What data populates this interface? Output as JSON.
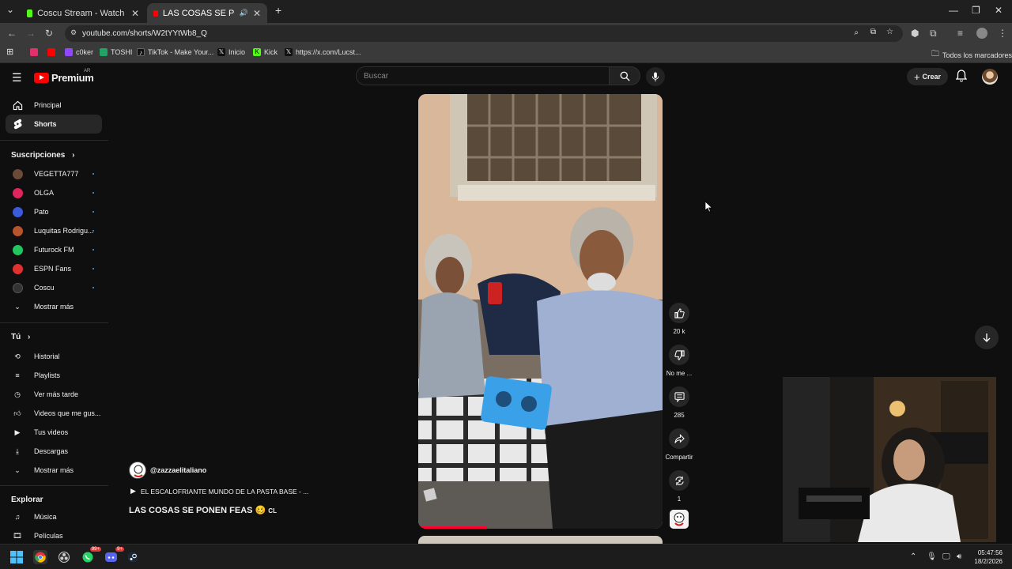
{
  "browser": {
    "tabs": [
      {
        "title": "Coscu Stream - Watch Live on K",
        "active": false
      },
      {
        "title": "LAS COSAS SE PONEN FEAS",
        "active": true
      }
    ],
    "new_tab": "+",
    "url": "youtube.com/shorts/W2tYYtWb8_Q",
    "bookmarks": [
      {
        "label": "",
        "icon": "instagram-icon",
        "color": "#e1306c"
      },
      {
        "label": "",
        "icon": "youtube-icon",
        "color": "#ff0000"
      },
      {
        "label": "c0ker",
        "icon": "twitch-icon",
        "color": "#9146ff"
      },
      {
        "label": "TOSHI",
        "icon": "sheets-icon",
        "color": "#21a366"
      },
      {
        "label": "TikTok - Make Your...",
        "icon": "tiktok-icon",
        "color": "#111"
      },
      {
        "label": "Inicio",
        "icon": "x-icon",
        "color": "#111"
      },
      {
        "label": "Kick",
        "icon": "kick-icon",
        "color": "#53fc18"
      },
      {
        "label": "https://x.com/Lucst...",
        "icon": "x-icon",
        "color": "#111"
      }
    ],
    "all_bookmarks": "Todos los marcadores"
  },
  "youtube": {
    "logo_text": "Premium",
    "region": "AR",
    "search_placeholder": "Buscar",
    "create_label": "Crear",
    "nav": [
      {
        "label": "Principal",
        "icon": "home-icon"
      },
      {
        "label": "Shorts",
        "icon": "shorts-icon",
        "active": true
      }
    ],
    "subscriptions_heading": "Suscripciones",
    "subscriptions": [
      {
        "label": "VEGETTA777",
        "color": "#6a4b3a"
      },
      {
        "label": "OLGA",
        "color": "#e0245e"
      },
      {
        "label": "Pato",
        "color": "#3b5bdb"
      },
      {
        "label": "Luquitas Rodrigu...",
        "color": "#b5542d"
      },
      {
        "label": "Futurock FM",
        "color": "#22c55e"
      },
      {
        "label": "ESPN Fans",
        "color": "#e03131"
      },
      {
        "label": "Coscu",
        "color": "#333333"
      }
    ],
    "show_more_1": "Mostrar más",
    "you_heading": "Tú",
    "you_items": [
      {
        "label": "Historial",
        "icon": "history-icon"
      },
      {
        "label": "Playlists",
        "icon": "playlist-icon"
      },
      {
        "label": "Ver más tarde",
        "icon": "clock-icon"
      },
      {
        "label": "Videos que me gus...",
        "icon": "like-icon"
      },
      {
        "label": "Tus videos",
        "icon": "video-icon"
      },
      {
        "label": "Descargas",
        "icon": "download-icon"
      }
    ],
    "show_more_2": "Mostrar más",
    "explore_heading": "Explorar",
    "explore_items": [
      {
        "label": "Música",
        "icon": "music-icon"
      },
      {
        "label": "Películas",
        "icon": "film-icon"
      }
    ]
  },
  "short": {
    "channel": "@zazzaelitaliano",
    "playlist": "EL ESCALOFRIANTE MUNDO DE LA PASTA BASE - ...",
    "title": "LAS COSAS SE PONEN FEAS 🥴",
    "title_suffix": "CL",
    "progress": 0.28,
    "actions": {
      "likes": "20 k",
      "dislike": "No me ...",
      "comments": "285",
      "share": "Compartir",
      "remix": "1"
    }
  },
  "taskbar": {
    "time": "05:47:56",
    "date": "18/2/2026",
    "whatsapp_badge": "99+",
    "discord_badge": "9+"
  }
}
